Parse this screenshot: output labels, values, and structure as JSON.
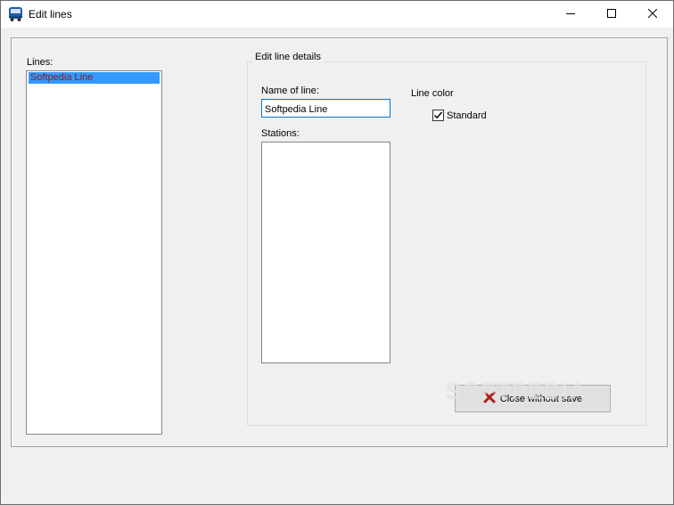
{
  "window": {
    "title": "Edit lines",
    "app_icon": "bus-icon",
    "controls": [
      "minimize-icon",
      "maximize-icon",
      "close-icon"
    ]
  },
  "lines": {
    "label": "Lines:",
    "items": [
      "Softpedia Line"
    ],
    "selected_index": 0
  },
  "details": {
    "group_title": "Edit line details",
    "name_label": "Name of line:",
    "name_value": "Softpedia Line",
    "stations_label": "Stations:",
    "stations": [],
    "line_color_label": "Line color",
    "standard_label": "Standard",
    "standard_checked": true
  },
  "actions": {
    "close_label": "Close without save",
    "close_icon": "red-x-icon"
  },
  "watermark": "SOFTPEDIA",
  "colors": {
    "selection": "#3399ff",
    "selected_text": "#8b1a1a",
    "close_icon": "#b01e1e",
    "input_focus_border": "#0078d7"
  }
}
